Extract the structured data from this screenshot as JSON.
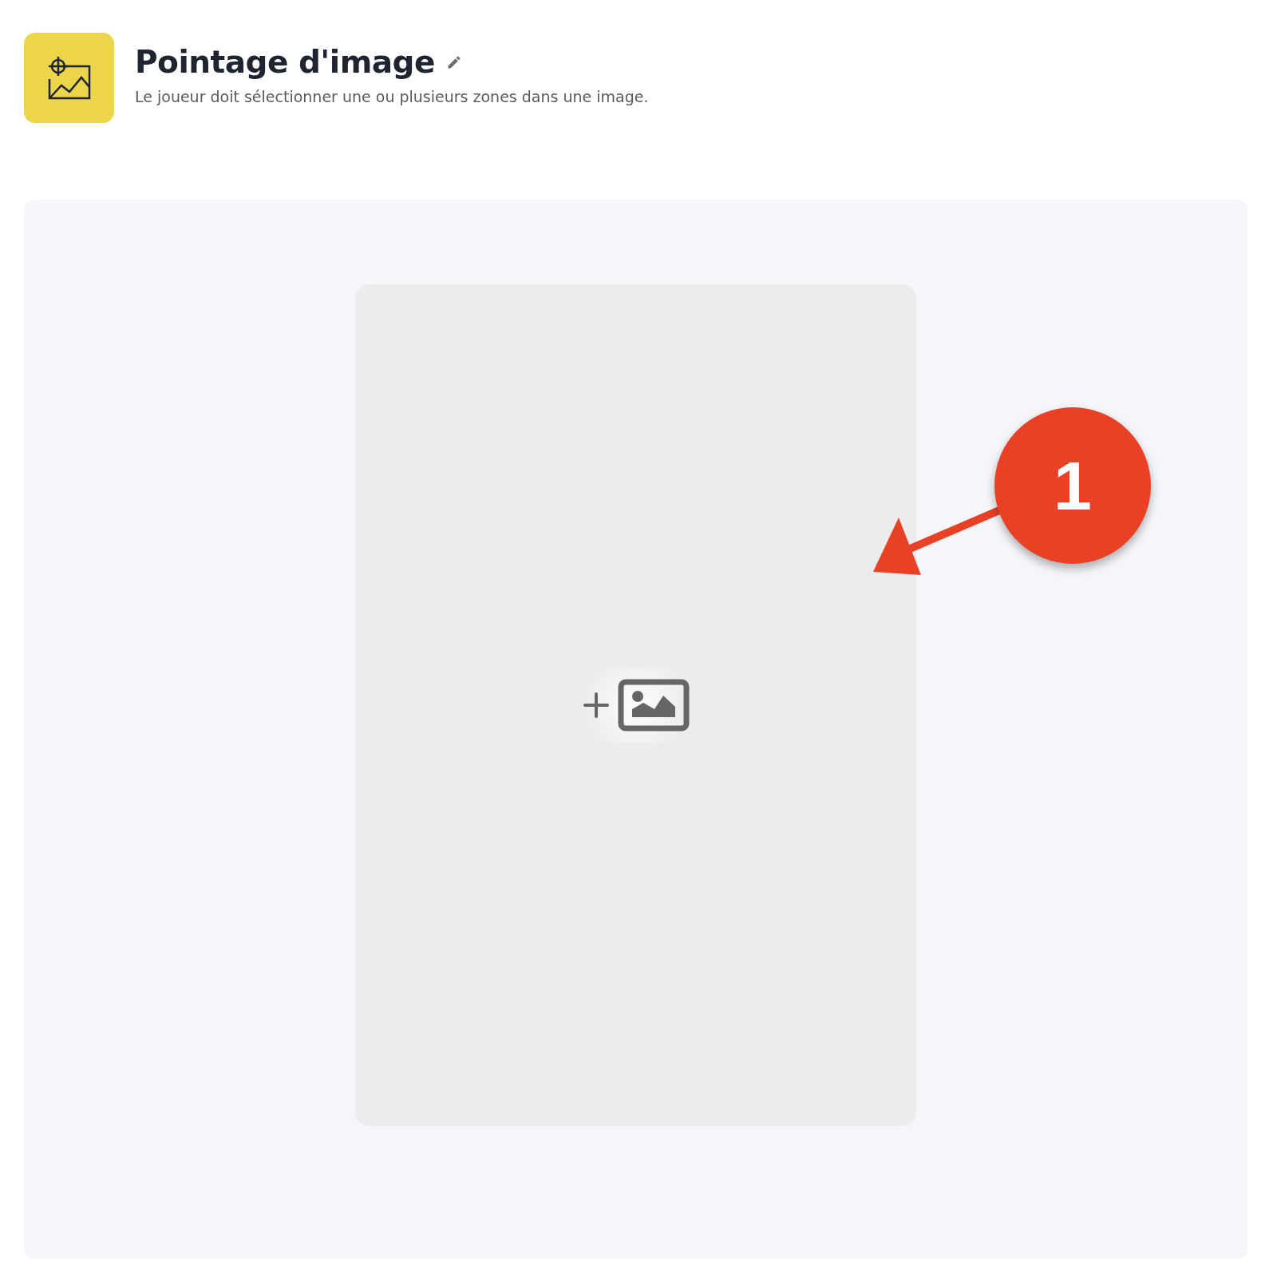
{
  "header": {
    "title": "Pointage d'image",
    "description": "Le joueur doit sélectionner une ou plusieurs zones dans une image."
  },
  "annotation": {
    "number": "1"
  }
}
